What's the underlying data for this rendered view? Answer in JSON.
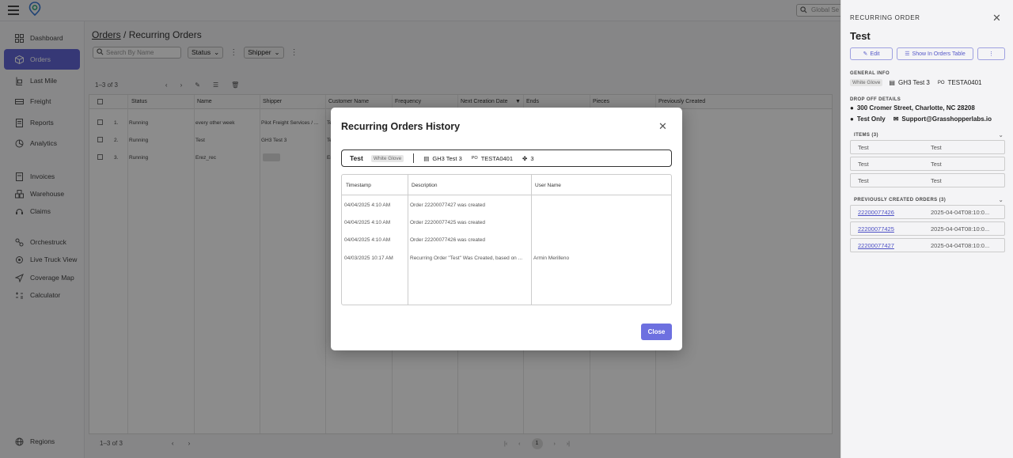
{
  "topbar": {
    "global_search_placeholder": "Global Se"
  },
  "sidebar": {
    "items": [
      {
        "label": "Dashboard",
        "icon": "dashboard-icon"
      },
      {
        "label": "Orders",
        "icon": "orders-icon",
        "active": true
      },
      {
        "label": "Last Mile",
        "icon": "last-mile-icon"
      },
      {
        "label": "Freight",
        "icon": "freight-icon"
      },
      {
        "label": "Reports",
        "icon": "reports-icon"
      },
      {
        "label": "Analytics",
        "icon": "analytics-icon"
      },
      {
        "label": "Invoices",
        "icon": "invoices-icon"
      },
      {
        "label": "Warehouse",
        "icon": "warehouse-icon"
      },
      {
        "label": "Claims",
        "icon": "claims-icon"
      },
      {
        "label": "Orchestruck",
        "icon": "orchestruck-icon"
      },
      {
        "label": "Live Truck View",
        "icon": "live-truck-icon"
      },
      {
        "label": "Coverage Map",
        "icon": "coverage-map-icon"
      },
      {
        "label": "Calculator",
        "icon": "calculator-icon"
      },
      {
        "label": "Regions",
        "icon": "globe-icon"
      }
    ]
  },
  "main": {
    "breadcrumb_root": "Orders",
    "breadcrumb_sep": " / ",
    "breadcrumb_current": "Recurring Orders",
    "search_placeholder": "Search By Name",
    "filter_status": "Status",
    "filter_shipper": "Shipper",
    "range_text": "1–3 of 3",
    "columns": [
      "Status",
      "Name",
      "Shipper",
      "Customer Name",
      "Frequency",
      "Next Creation Date",
      "Ends",
      "Pieces",
      "Previously Created"
    ],
    "rows": [
      {
        "num": "1.",
        "status": "Running",
        "name": "every other week",
        "shipper": "Pilot Freight Services / ...",
        "customer": "Te"
      },
      {
        "num": "2.",
        "status": "Running",
        "name": "Test",
        "shipper": "GH3 Test 3",
        "customer": "Te"
      },
      {
        "num": "3.",
        "status": "Running",
        "name": "Erez_rec",
        "shipper": "",
        "customer": "Er"
      }
    ],
    "footer_range": "1–3 of 3",
    "page_current": "1"
  },
  "modal": {
    "title": "Recurring Orders History",
    "order_name": "Test",
    "service_badge": "White Glove",
    "shipper": "GH3 Test 3",
    "po": "TESTA0401",
    "pieces": "3",
    "columns": {
      "timestamp": "Timestamp",
      "description": "Description",
      "user": "User Name"
    },
    "rows": [
      {
        "timestamp": "04/04/2025 4:10 AM",
        "description": "Order 22200077427 was created",
        "user": ""
      },
      {
        "timestamp": "04/04/2025 4:10 AM",
        "description": "Order 22200077425 was created",
        "user": ""
      },
      {
        "timestamp": "04/04/2025 4:10 AM",
        "description": "Order 22200077426 was created",
        "user": ""
      },
      {
        "timestamp": "04/03/2025 10:17 AM",
        "description": "Recurring Order \"Test\" Was Created, based on ...",
        "user": "Armin Merilleno"
      }
    ],
    "close_label": "Close"
  },
  "panel": {
    "heading": "RECURRING ORDER",
    "title": "Test",
    "edit_label": "Edit",
    "show_label": "Show In Orders Table",
    "general_info": "GENERAL INFO",
    "service_badge": "White Glove",
    "shipper": "GH3 Test 3",
    "po": "TESTA0401",
    "dropoff_heading": "DROP OFF DETAILS",
    "address": "300 Cromer Street, Charlotte, NC 28208",
    "contact_name": "Test Only",
    "email": "Support@Grasshopperlabs.io",
    "items_heading": "ITEMS (3)",
    "items": [
      {
        "a": "Test",
        "b": "Test"
      },
      {
        "a": "Test",
        "b": "Test"
      },
      {
        "a": "Test",
        "b": "Test"
      }
    ],
    "prev_heading": "PREVIOUSLY CREATED ORDERS (3)",
    "prev_orders": [
      {
        "id": "22200077426",
        "date": "2025-04-04T08:10:0..."
      },
      {
        "id": "22200077425",
        "date": "2025-04-04T08:10:0..."
      },
      {
        "id": "22200077427",
        "date": "2025-04-04T08:10:0..."
      }
    ]
  },
  "colors": {
    "accent": "#6366d8",
    "close_button": "#6d70e0",
    "link": "#4b4ec4"
  }
}
